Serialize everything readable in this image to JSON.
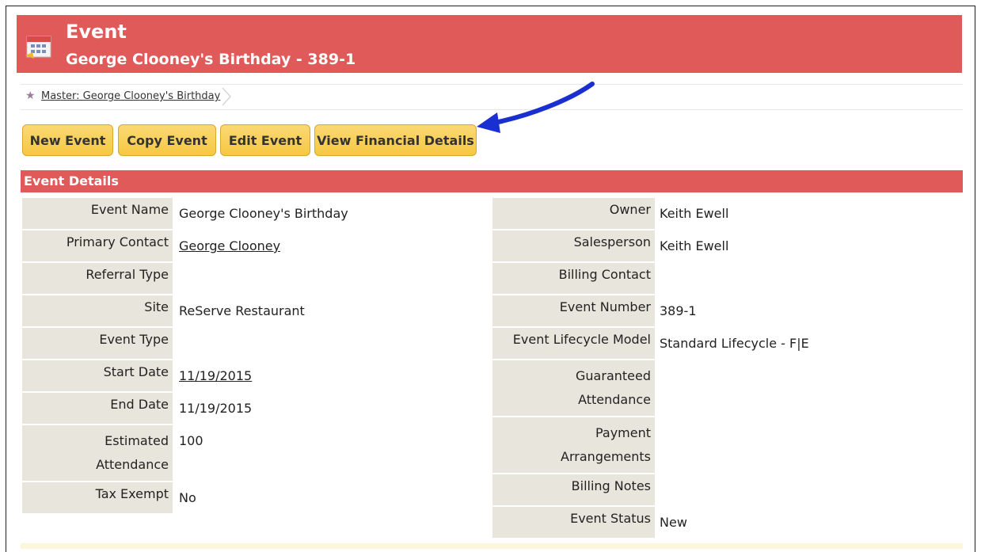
{
  "header": {
    "title": "Event",
    "subtitle": "George Clooney's Birthday - 389-1",
    "icon": "calendar-icon",
    "color": "#e05a59"
  },
  "breadcrumb": {
    "icon": "star-icon",
    "label": "Master: George Clooney's Birthday"
  },
  "toolbar": {
    "new_event": "New Event",
    "copy_event": "Copy Event",
    "edit_event": "Edit Event",
    "view_financial": "View Financial Details"
  },
  "section": {
    "title": "Event Details"
  },
  "details_left": {
    "event_name": {
      "label": "Event Name",
      "value": "George Clooney's Birthday"
    },
    "primary_contact": {
      "label": "Primary Contact",
      "value": "George Clooney"
    },
    "referral_type": {
      "label": "Referral Type",
      "value": ""
    },
    "site": {
      "label": "Site",
      "value": "ReServe Restaurant"
    },
    "event_type": {
      "label": "Event Type",
      "value": ""
    },
    "start_date": {
      "label": "Start Date",
      "value": "11/19/2015"
    },
    "end_date": {
      "label": "End Date",
      "value": "11/19/2015"
    },
    "estimated_attendance": {
      "label1": "Estimated",
      "label2": "Attendance",
      "value": "100"
    },
    "tax_exempt": {
      "label": "Tax Exempt",
      "value": "No"
    }
  },
  "details_right": {
    "owner": {
      "label": "Owner",
      "value": "Keith Ewell"
    },
    "salesperson": {
      "label": "Salesperson",
      "value": "Keith Ewell"
    },
    "billing_contact": {
      "label": "Billing Contact",
      "value": ""
    },
    "event_number": {
      "label": "Event Number",
      "value": "389-1"
    },
    "lifecycle_model": {
      "label": "Event Lifecycle Model",
      "value": "Standard Lifecycle - F|E"
    },
    "guaranteed_attendance": {
      "label1": "Guaranteed",
      "label2": "Attendance",
      "value": ""
    },
    "payment_arrangements": {
      "label1": "Payment",
      "label2": "Arrangements",
      "value": ""
    },
    "billing_notes": {
      "label": "Billing Notes",
      "value": ""
    },
    "event_status": {
      "label": "Event Status",
      "value": "New"
    }
  },
  "colors": {
    "accent": "#e05a59",
    "button": "#f5c843",
    "label_bg": "#e8e6dc",
    "arrow": "#1a2fd0"
  }
}
